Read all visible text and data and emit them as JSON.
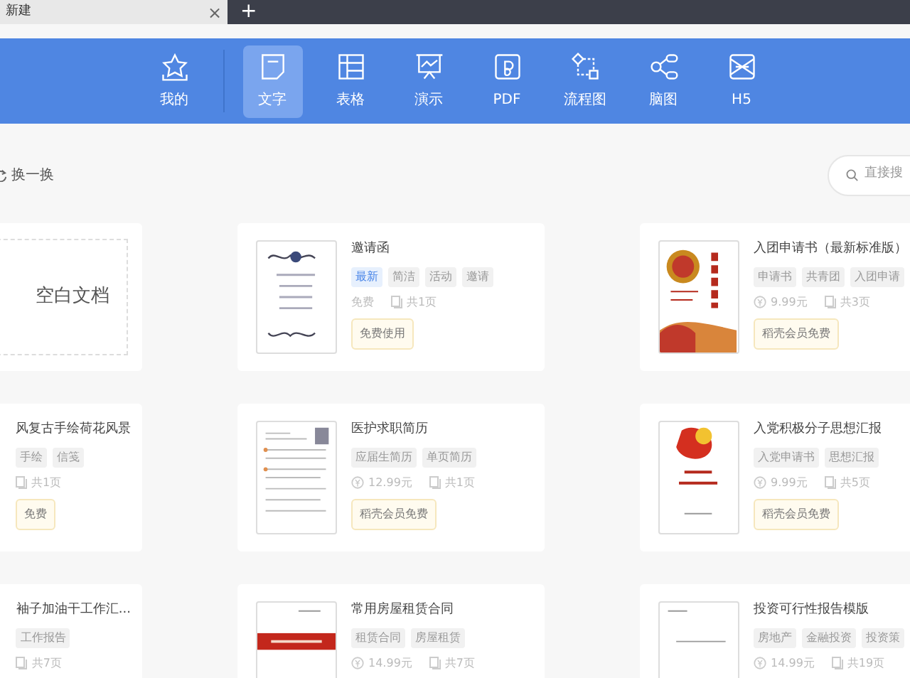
{
  "tab": {
    "title": "新建",
    "close": "×"
  },
  "new_tab": "+",
  "toolbar": {
    "items": [
      {
        "label": "我的",
        "selected": false
      },
      {
        "label": "文字",
        "selected": true
      },
      {
        "label": "表格",
        "selected": false
      },
      {
        "label": "演示",
        "selected": false
      },
      {
        "label": "PDF",
        "selected": false
      },
      {
        "label": "流程图",
        "selected": false
      },
      {
        "label": "脑图",
        "selected": false
      },
      {
        "label": "H5",
        "selected": false
      }
    ]
  },
  "refresh": {
    "label": "换一换"
  },
  "search": {
    "placeholder": "直接搜"
  },
  "cards": [
    {
      "kind": "blank",
      "title": "空白文档"
    },
    {
      "kind": "template",
      "title": "邀请函",
      "tags": [
        {
          "label": "最新",
          "highlight": true
        },
        {
          "label": "简洁",
          "highlight": false
        },
        {
          "label": "活动",
          "highlight": false
        },
        {
          "label": "邀请",
          "highlight": false
        }
      ],
      "price": "免费",
      "price_icon": false,
      "pages": "共1页",
      "button": "免费使用"
    },
    {
      "kind": "template",
      "title": "入团申请书（最新标准版）",
      "tags": [
        {
          "label": "申请书",
          "highlight": false
        },
        {
          "label": "共青团",
          "highlight": false
        },
        {
          "label": "入团申请",
          "highlight": false
        }
      ],
      "price": "9.99元",
      "price_icon": true,
      "pages": "共3页",
      "button": "稻壳会员免费"
    },
    {
      "kind": "cut",
      "title": "风复古手绘荷花风景",
      "tags": [
        {
          "label": "手绘",
          "highlight": false
        },
        {
          "label": "信笺",
          "highlight": false
        }
      ],
      "pages": "共1页",
      "button": "免费"
    },
    {
      "kind": "template",
      "title": "医护求职简历",
      "tags": [
        {
          "label": "应届生简历",
          "highlight": false
        },
        {
          "label": "单页简历",
          "highlight": false
        }
      ],
      "price": "12.99元",
      "price_icon": true,
      "pages": "共1页",
      "button": "稻壳会员免费"
    },
    {
      "kind": "template",
      "title": "入党积极分子思想汇报",
      "tags": [
        {
          "label": "入党申请书",
          "highlight": false
        },
        {
          "label": "思想汇报",
          "highlight": false
        }
      ],
      "price": "9.99元",
      "price_icon": true,
      "pages": "共5页",
      "button": "稻壳会员免费"
    },
    {
      "kind": "cut",
      "title": "袖子加油干工作汇...",
      "tags": [
        {
          "label": "工作报告",
          "highlight": false
        }
      ],
      "pages": "共7页"
    },
    {
      "kind": "template",
      "title": "常用房屋租赁合同",
      "tags": [
        {
          "label": "租赁合同",
          "highlight": false
        },
        {
          "label": "房屋租赁",
          "highlight": false
        }
      ],
      "price": "14.99元",
      "price_icon": true,
      "pages": "共7页"
    },
    {
      "kind": "template",
      "title": "投资可行性报告模版",
      "tags": [
        {
          "label": "房地产",
          "highlight": false
        },
        {
          "label": "金融投资",
          "highlight": false
        },
        {
          "label": "投资策",
          "highlight": false
        }
      ],
      "price": "14.99元",
      "price_icon": true,
      "pages": "共19页"
    }
  ]
}
